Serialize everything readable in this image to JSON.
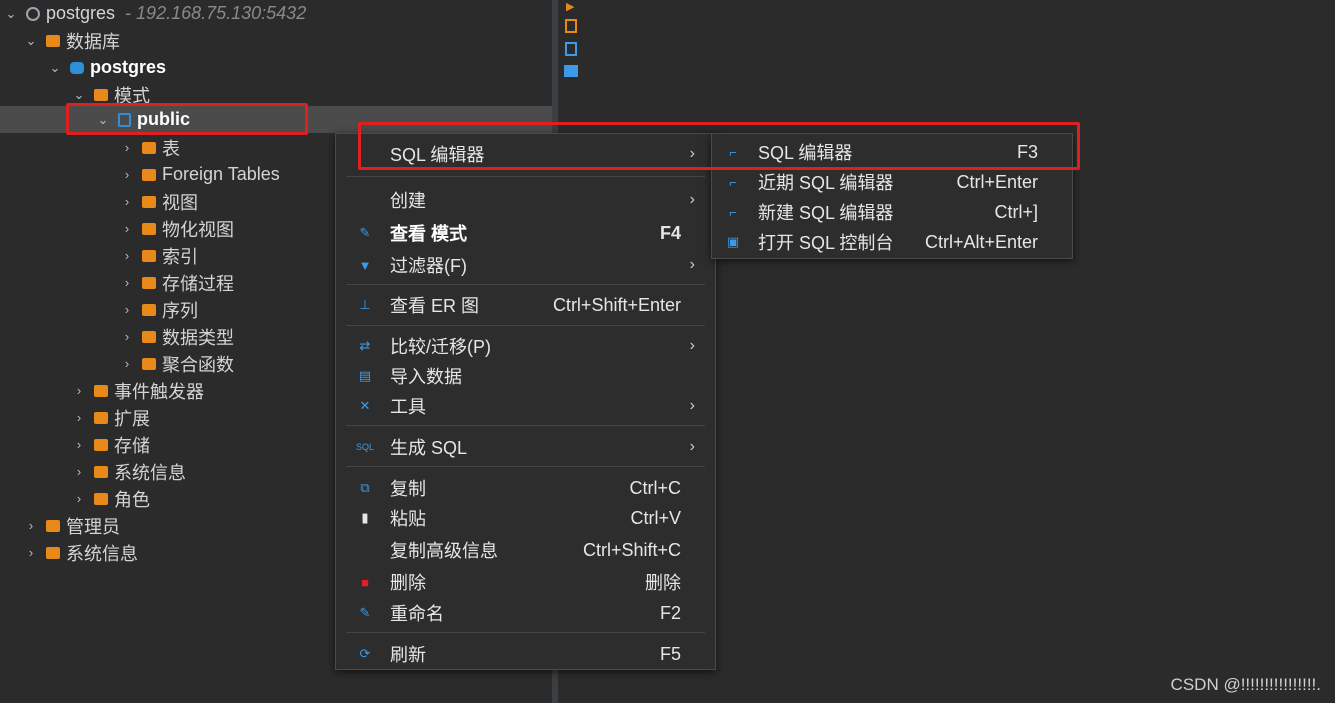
{
  "tree": {
    "connection": {
      "name": "postgres",
      "host": "- 192.168.75.130:5432"
    },
    "databases_label": "数据库",
    "database": "postgres",
    "schemas_label": "模式",
    "schema": "public",
    "schema_children": [
      "表",
      "Foreign Tables",
      "视图",
      "物化视图",
      "索引",
      "存储过程",
      "序列",
      "数据类型",
      "聚合函数"
    ],
    "db_children": [
      "事件触发器",
      "扩展",
      "存储",
      "系统信息",
      "角色"
    ],
    "conn_children": [
      "管理员",
      "系统信息"
    ]
  },
  "context_menu": {
    "items": [
      {
        "label": "SQL 编辑器",
        "shortcut": "",
        "submenu": true,
        "icon": ""
      },
      {
        "label": "创建",
        "shortcut": "",
        "submenu": true,
        "icon": ""
      },
      {
        "label": "查看 模式",
        "shortcut": "F4",
        "submenu": false,
        "icon": "pencil-icon",
        "bold": true
      },
      {
        "label": "过滤器(F)",
        "shortcut": "",
        "submenu": true,
        "icon": "filter-icon"
      },
      {
        "label": "查看 ER 图",
        "shortcut": "Ctrl+Shift+Enter",
        "submenu": false,
        "icon": "er-diagram-icon"
      },
      {
        "label": "比较/迁移(P)",
        "shortcut": "",
        "submenu": true,
        "icon": "compare-icon"
      },
      {
        "label": "导入数据",
        "shortcut": "",
        "submenu": false,
        "icon": "import-icon"
      },
      {
        "label": "工具",
        "shortcut": "",
        "submenu": true,
        "icon": "tools-icon"
      },
      {
        "label": "生成 SQL",
        "shortcut": "",
        "submenu": true,
        "icon": "sql-icon"
      },
      {
        "label": "复制",
        "shortcut": "Ctrl+C",
        "submenu": false,
        "icon": "copy-icon"
      },
      {
        "label": "粘贴",
        "shortcut": "Ctrl+V",
        "submenu": false,
        "icon": "paste-icon"
      },
      {
        "label": "复制高级信息",
        "shortcut": "Ctrl+Shift+C",
        "submenu": false,
        "icon": ""
      },
      {
        "label": "删除",
        "shortcut": "删除",
        "submenu": false,
        "icon": "delete-icon"
      },
      {
        "label": "重命名",
        "shortcut": "F2",
        "submenu": false,
        "icon": "rename-icon"
      },
      {
        "label": "刷新",
        "shortcut": "F5",
        "submenu": false,
        "icon": "refresh-icon"
      }
    ]
  },
  "submenu": {
    "items": [
      {
        "label": "SQL 编辑器",
        "shortcut": "F3",
        "icon": "sql-editor-icon"
      },
      {
        "label": "近期 SQL 编辑器",
        "shortcut": "Ctrl+Enter",
        "icon": "recent-sql-editor-icon"
      },
      {
        "label": "新建 SQL 编辑器",
        "shortcut": "Ctrl+]",
        "icon": "new-sql-editor-icon"
      },
      {
        "label": "打开 SQL 控制台",
        "shortcut": "Ctrl+Alt+Enter",
        "icon": "console-icon"
      }
    ]
  },
  "watermark": "CSDN @!!!!!!!!!!!!!!!!.",
  "colors": {
    "highlight": "#e02020",
    "accent": "#2f8fd6",
    "folder": "#e8891a"
  }
}
